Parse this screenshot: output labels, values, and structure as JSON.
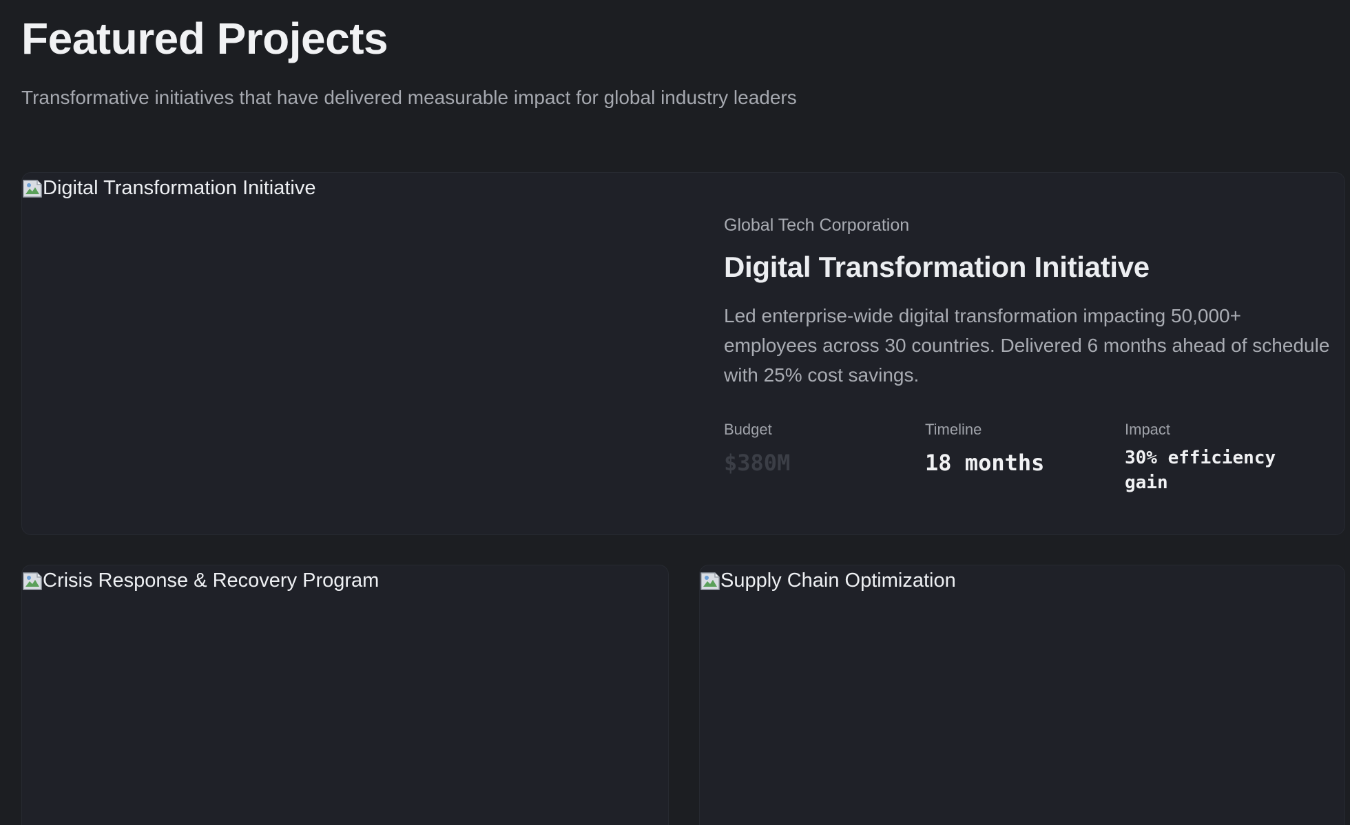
{
  "header": {
    "title": "Featured Projects",
    "subtitle": "Transformative initiatives that have delivered measurable impact for global industry leaders"
  },
  "featured": {
    "image_alt": "Digital Transformation Initiative",
    "client": "Global Tech Corporation",
    "title": "Digital Transformation Initiative",
    "description": "Led enterprise-wide digital transformation impacting 50,000+ employees across 30 countries. Delivered 6 months ahead of schedule with 25% cost savings.",
    "metrics": [
      {
        "label": "Budget",
        "value": "$380M"
      },
      {
        "label": "Timeline",
        "value": "18 months"
      },
      {
        "label": "Impact",
        "value": "30% efficiency gain"
      }
    ]
  },
  "projects": [
    {
      "image_alt": "Crisis Response & Recovery Program"
    },
    {
      "image_alt": "Supply Chain Optimization"
    }
  ],
  "colors": {
    "background": "#1c1e22",
    "card": "#1f2128",
    "muted_value": "#3b3e46"
  },
  "icons": {
    "broken_image": "broken-image-icon"
  }
}
